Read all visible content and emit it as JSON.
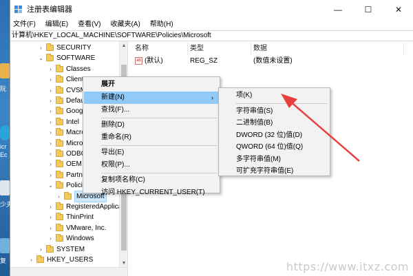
{
  "window": {
    "title": "注册表编辑器",
    "minimize": "—",
    "maximize": "☐",
    "close": "✕"
  },
  "menubar": [
    "文件(F)",
    "编辑(E)",
    "查看(V)",
    "收藏夹(A)",
    "帮助(H)"
  ],
  "address": "计算机\\HKEY_LOCAL_MACHINE\\SOFTWARE\\Policies\\Microsoft",
  "desktop_labels": [
    "阮",
    "icr",
    "Ec",
    "少夫",
    "复"
  ],
  "tree": [
    {
      "label": "SECURITY",
      "indent": 1,
      "toggle": "›"
    },
    {
      "label": "SOFTWARE",
      "indent": 1,
      "toggle": "⌄"
    },
    {
      "label": "Classes",
      "indent": 2,
      "toggle": "›"
    },
    {
      "label": "Clients",
      "indent": 2,
      "toggle": "›"
    },
    {
      "label": "CVSM",
      "indent": 2,
      "toggle": "›"
    },
    {
      "label": "DefaultU",
      "indent": 2,
      "toggle": "›"
    },
    {
      "label": "Google",
      "indent": 2,
      "toggle": "›"
    },
    {
      "label": "Intel",
      "indent": 2,
      "toggle": "›"
    },
    {
      "label": "Macrom",
      "indent": 2,
      "toggle": "›"
    },
    {
      "label": "Microsof",
      "indent": 2,
      "toggle": "›"
    },
    {
      "label": "ODBC",
      "indent": 2,
      "toggle": "›"
    },
    {
      "label": "OEM",
      "indent": 2,
      "toggle": "›"
    },
    {
      "label": "Partner",
      "indent": 2,
      "toggle": "›"
    },
    {
      "label": "Policies",
      "indent": 2,
      "toggle": "⌄"
    },
    {
      "label": "Microsoft",
      "indent": 3,
      "toggle": "›",
      "selected": true
    },
    {
      "label": "RegisteredApplica",
      "indent": 2,
      "toggle": "›"
    },
    {
      "label": "ThinPrint",
      "indent": 2,
      "toggle": "›"
    },
    {
      "label": "VMware, Inc.",
      "indent": 2,
      "toggle": "›"
    },
    {
      "label": "Windows",
      "indent": 2,
      "toggle": "›"
    },
    {
      "label": "SYSTEM",
      "indent": 1,
      "toggle": "›"
    },
    {
      "label": "HKEY_USERS",
      "indent": 0,
      "toggle": "›"
    }
  ],
  "values_pane": {
    "columns": [
      "名称",
      "类型",
      "数据"
    ],
    "rows": [
      {
        "name": "(默认)",
        "type": "REG_SZ",
        "data": "(数值未设置)",
        "icon": "ab"
      }
    ]
  },
  "context_menu": {
    "items": [
      {
        "label": "展开",
        "bold": true
      },
      {
        "label": "新建(N)",
        "submenu": true,
        "highlighted": true
      },
      {
        "label": "查找(F)..."
      },
      {
        "sep": true
      },
      {
        "label": "删除(D)"
      },
      {
        "label": "重命名(R)"
      },
      {
        "sep": true
      },
      {
        "label": "导出(E)"
      },
      {
        "label": "权限(P)..."
      },
      {
        "sep": true
      },
      {
        "label": "复制项名称(C)"
      },
      {
        "label": "访问 HKEY_CURRENT_USER(T)"
      }
    ]
  },
  "submenu": {
    "items": [
      {
        "label": "项(K)"
      },
      {
        "sep": true
      },
      {
        "label": "字符串值(S)"
      },
      {
        "label": "二进制值(B)"
      },
      {
        "label": "DWORD (32 位)值(D)"
      },
      {
        "label": "QWORD (64 位)值(Q)"
      },
      {
        "label": "多字符串值(M)"
      },
      {
        "label": "可扩充字符串值(E)"
      }
    ]
  },
  "watermark": "https://www.itxz.com",
  "colors": {
    "highlight": "#91c9f7",
    "selection": "#cce8ff",
    "arrow": "#e84040"
  }
}
